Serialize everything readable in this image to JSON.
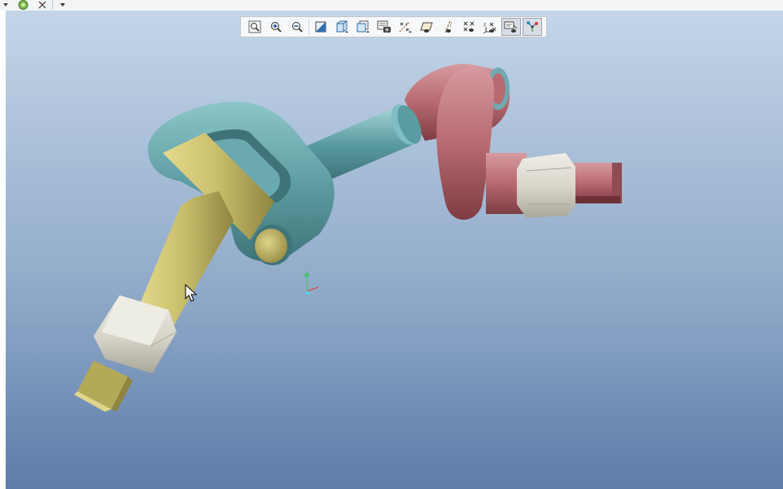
{
  "window": {
    "title_icons": [
      "dropdown-arrow-icon",
      "globe-icon",
      "close-x-icon",
      "overflow-arrow-icon"
    ]
  },
  "view_toolbar": {
    "buttons": [
      {
        "icon": "refit-icon",
        "pressed": false
      },
      {
        "icon": "zoom-in-icon",
        "pressed": false
      },
      {
        "icon": "zoom-out-icon",
        "pressed": false
      },
      {
        "icon": "repaint-icon",
        "pressed": false
      },
      {
        "icon": "display-style-icon",
        "pressed": false
      },
      {
        "icon": "saved-orientations-icon",
        "pressed": false
      },
      {
        "icon": "view-manager-icon",
        "pressed": false
      },
      {
        "icon": "datum-display-filters-icon",
        "pressed": false
      },
      {
        "icon": "plane-display-icon",
        "pressed": false
      },
      {
        "icon": "axis-display-icon",
        "pressed": false
      },
      {
        "icon": "point-display-icon",
        "pressed": false
      },
      {
        "icon": "csys-display-icon",
        "pressed": false
      },
      {
        "icon": "annotation-display-icon",
        "pressed": true
      },
      {
        "icon": "spin-center-icon",
        "pressed": true
      }
    ]
  },
  "model": {
    "colors": {
      "background_top": "#c4d5e8",
      "background_bottom": "#5f7ba8",
      "teal_part": "#5f9ea3",
      "yellow_part": "#c8bd6a",
      "red_part": "#b86a70",
      "nut": "#dcdad0"
    }
  }
}
